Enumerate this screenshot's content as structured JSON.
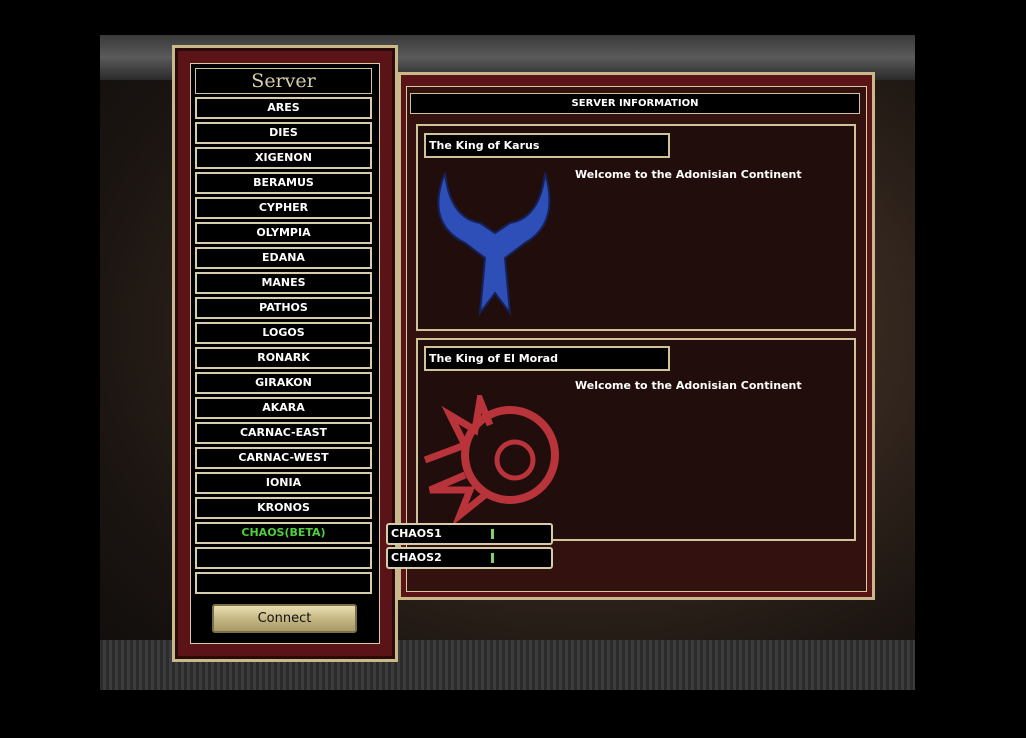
{
  "server_panel": {
    "title": "Server",
    "servers": [
      {
        "name": "ARES"
      },
      {
        "name": "DIES"
      },
      {
        "name": "XIGENON"
      },
      {
        "name": "BERAMUS"
      },
      {
        "name": "CYPHER"
      },
      {
        "name": "OLYMPIA"
      },
      {
        "name": "EDANA"
      },
      {
        "name": "MANES"
      },
      {
        "name": "PATHOS"
      },
      {
        "name": "LOGOS"
      },
      {
        "name": "RONARK"
      },
      {
        "name": "GIRAKON"
      },
      {
        "name": "AKARA"
      },
      {
        "name": "CARNAC-EAST"
      },
      {
        "name": "CARNAC-WEST"
      },
      {
        "name": "IONIA"
      },
      {
        "name": "KRONOS"
      },
      {
        "name": "CHAOS(BETA)",
        "color": "#4fcf3e"
      },
      {
        "name": ""
      },
      {
        "name": ""
      }
    ],
    "connect_label": "Connect"
  },
  "sub_servers": [
    {
      "name": "CHAOS1",
      "load_color": "#7fd36a"
    },
    {
      "name": "CHAOS2",
      "load_color": "#7fd36a"
    }
  ],
  "info_panel": {
    "header": "SERVER INFORMATION",
    "karus": {
      "king": "The King of Karus",
      "welcome": "Welcome to the Adonisian Continent",
      "emblem": "karus-horns-emblem",
      "color": "#2f4fb8"
    },
    "elmorad": {
      "king": "The King of El Morad",
      "welcome": "Welcome to the Adonisian Continent",
      "emblem": "elmorad-sun-emblem",
      "color": "#b8343a"
    }
  }
}
